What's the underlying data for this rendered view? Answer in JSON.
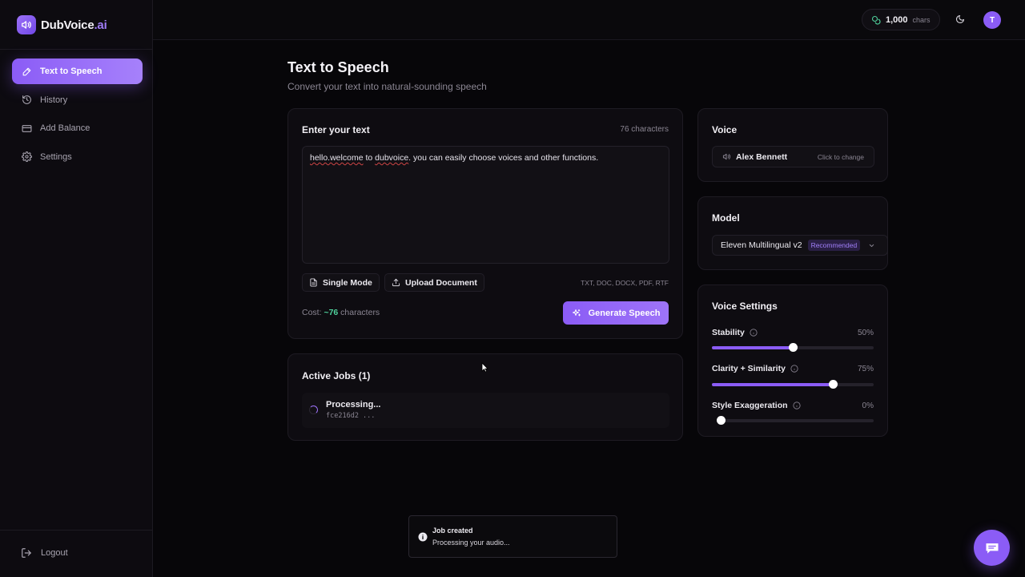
{
  "brand": {
    "name": "DubVoice",
    "suffix": ".ai"
  },
  "sidebar": {
    "items": [
      {
        "label": "Text to Speech",
        "icon": "mic-pen-icon",
        "active": true
      },
      {
        "label": "History",
        "icon": "history-icon",
        "active": false
      },
      {
        "label": "Add Balance",
        "icon": "credit-card-icon",
        "active": false
      },
      {
        "label": "Settings",
        "icon": "gear-icon",
        "active": false
      }
    ],
    "logout_label": "Logout"
  },
  "topbar": {
    "credits_value": "1,000",
    "credits_unit": "chars",
    "avatar_initial": "T"
  },
  "page": {
    "title": "Text to Speech",
    "subtitle": "Convert your text into natural-sounding speech"
  },
  "editor": {
    "title": "Enter your text",
    "char_count": "76 characters",
    "text_flagged": "hello.welcome",
    "text_mid": " to ",
    "text_flagged2": "dubvoice",
    "text_rest": ". you can easily choose voices and other functions.",
    "single_mode_label": "Single Mode",
    "upload_label": "Upload Document",
    "formats": "TXT, DOC, DOCX, PDF, RTF",
    "cost_prefix": "Cost: ",
    "cost_value": "~76",
    "cost_suffix": " characters",
    "generate_label": "Generate Speech"
  },
  "jobs": {
    "title": "Active Jobs (1)",
    "items": [
      {
        "status": "Processing...",
        "id": "fce216d2 ..."
      }
    ]
  },
  "voice": {
    "title": "Voice",
    "name": "Alex Bennett",
    "hint": "Click to change"
  },
  "model": {
    "title": "Model",
    "name": "Eleven Multilingual v2",
    "badge": "Recommended"
  },
  "voice_settings": {
    "title": "Voice Settings",
    "sliders": [
      {
        "label": "Stability",
        "value_text": "50%",
        "value": 50
      },
      {
        "label": "Clarity + Similarity",
        "value_text": "75%",
        "value": 75
      },
      {
        "label": "Style Exaggeration",
        "value_text": "0%",
        "value": 0
      }
    ]
  },
  "toast": {
    "title": "Job created",
    "message": "Processing your audio..."
  },
  "colors": {
    "accent": "#8b5cf6",
    "success": "#4fd19c",
    "background": "#070609"
  }
}
